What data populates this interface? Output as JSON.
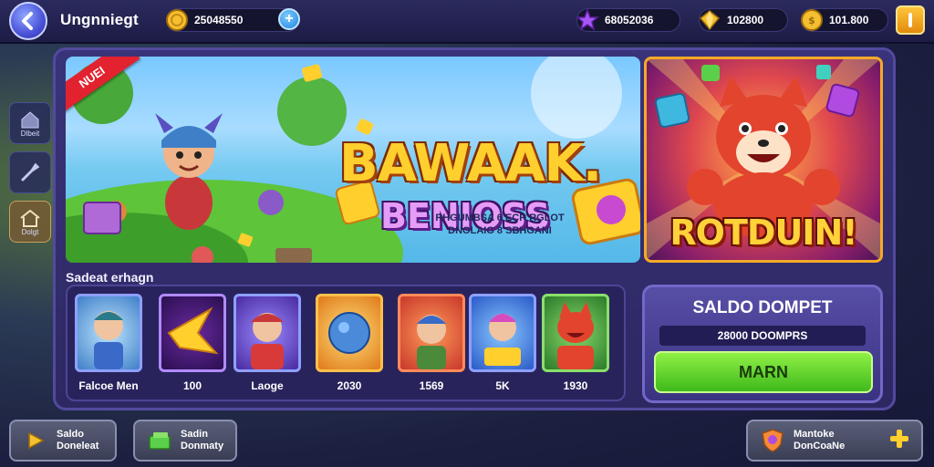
{
  "header": {
    "title": "Ungnniegt",
    "currencies": [
      {
        "icon": "coin-icon",
        "value": "25048550",
        "color": "#f5c030"
      },
      {
        "icon": "purple-gem-icon",
        "value": "68052036",
        "color": "#a855f7"
      },
      {
        "icon": "gold-gem-icon",
        "value": "102800",
        "color": "#f5c030"
      },
      {
        "icon": "coin-icon",
        "value": "101.800",
        "color": "#f5c030"
      }
    ]
  },
  "sidebar": {
    "items": [
      {
        "label": "Dlbeit",
        "icon": "home-icon"
      },
      {
        "label": "",
        "icon": "tools-icon"
      },
      {
        "label": "Dolgt",
        "icon": "house-icon"
      }
    ]
  },
  "hero": {
    "ribbon": "NUEI",
    "title": "BAWAAK.",
    "subtitle": "BENIOSS",
    "description_line1": "RHGUMBSA 6 ECR RGLOT",
    "description_line2": "DNOLAIG 8 SBHGANI"
  },
  "promo": {
    "label": "ROTDUIN!"
  },
  "games": {
    "section_label": "Sadeat erhagn",
    "items": [
      {
        "name": "Falcoe Men"
      },
      {
        "name": "100"
      },
      {
        "name": "Laoge"
      },
      {
        "name": "2030"
      },
      {
        "name": "1569"
      },
      {
        "name": "5K"
      },
      {
        "name": "1930"
      }
    ]
  },
  "wallet": {
    "title": "SALDO DOMPET",
    "balance": "28000 DOOMPRS",
    "button": "MARN"
  },
  "footer": {
    "left_button_line1": "Saldo",
    "left_button_line2": "Doneleat",
    "mid_button_line1": "Sadin",
    "mid_button_line2": "Donmaty",
    "right_button_line1": "Mantoke",
    "right_button_line2": "DonCoaNe"
  },
  "colors": {
    "accent_gold": "#ffcf2e",
    "accent_green": "#3fba1c",
    "panel_purple": "#39337a",
    "badge_red": "#e2222e"
  }
}
